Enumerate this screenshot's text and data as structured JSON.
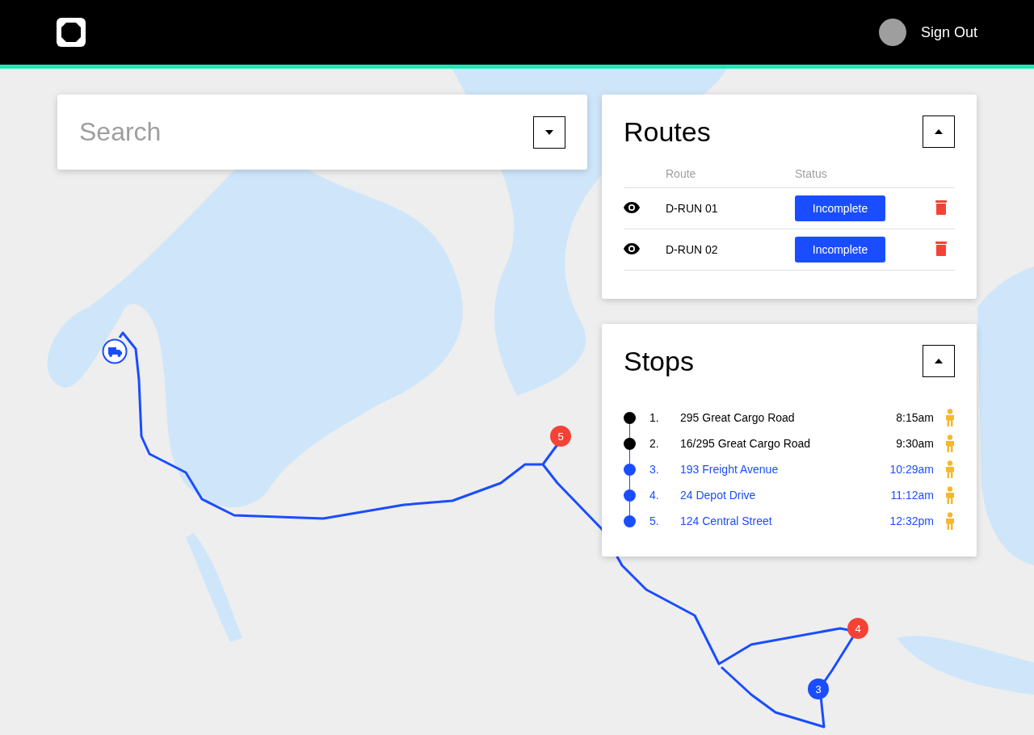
{
  "header": {
    "sign_out": "Sign Out"
  },
  "search": {
    "placeholder": "Search"
  },
  "routes": {
    "title": "Routes",
    "expanded": true,
    "columns": [
      "Route",
      "Status"
    ],
    "rows": [
      {
        "name": "D-RUN 01",
        "status": "Incomplete"
      },
      {
        "name": "D-RUN 02",
        "status": "Incomplete"
      }
    ]
  },
  "stops": {
    "title": "Stops",
    "expanded": true,
    "items": [
      {
        "number": "1.",
        "address": "295 Great Cargo Road",
        "time": "8:15am",
        "done": true
      },
      {
        "number": "2.",
        "address": "16/295 Great Cargo Road",
        "time": "9:30am",
        "done": true
      },
      {
        "number": "3.",
        "address": "193 Freight Avenue",
        "time": "10:29am",
        "done": false
      },
      {
        "number": "4.",
        "address": "24 Depot Drive",
        "time": "11:12am",
        "done": false
      },
      {
        "number": "5.",
        "address": "124 Central Street",
        "time": "12:32pm",
        "done": false
      }
    ]
  },
  "map": {
    "markers": [
      {
        "label": "5",
        "color": "#f44336"
      },
      {
        "label": "4",
        "color": "#f44336"
      },
      {
        "label": "3",
        "color": "#1a4dff"
      }
    ]
  }
}
